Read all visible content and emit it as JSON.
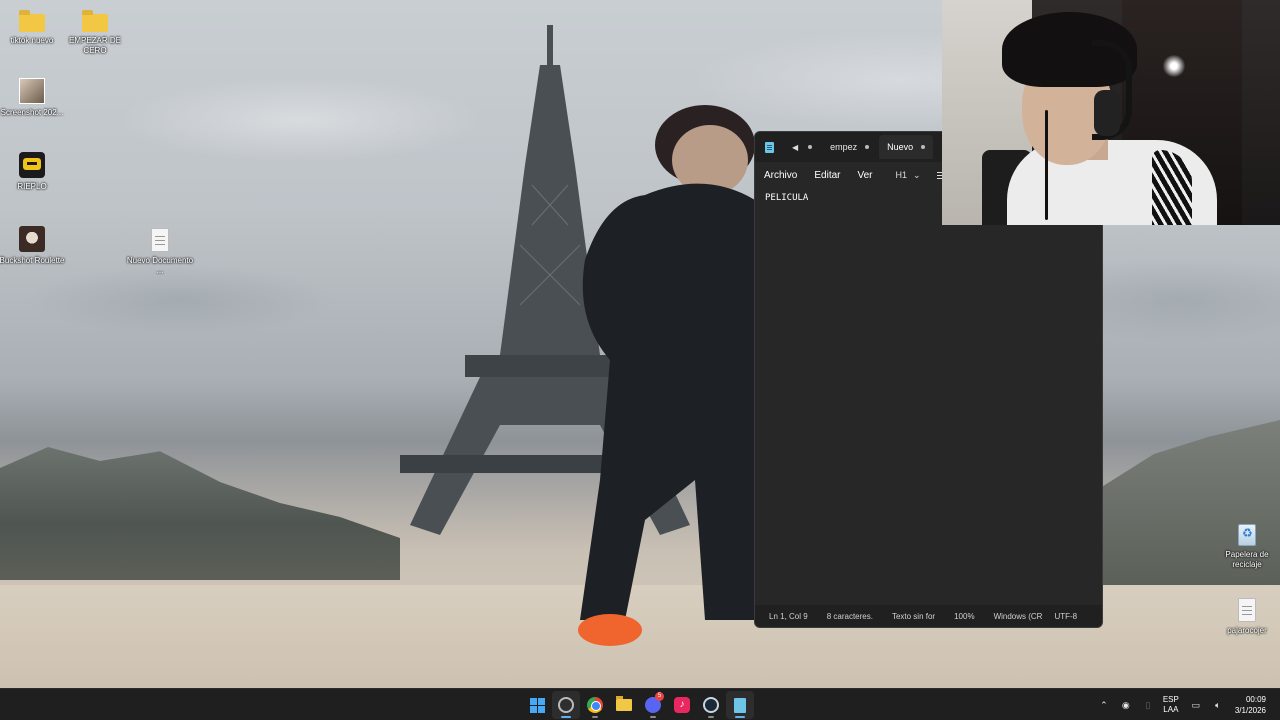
{
  "desktop": {
    "icons": [
      {
        "label": "tiktok nuevo",
        "icon": "folder-icon"
      },
      {
        "label": "EMPEZAR DE CERO",
        "icon": "folder-icon"
      },
      {
        "label": "Screenshot 202...",
        "icon": "image-icon"
      },
      {
        "label": "RIEPLO",
        "icon": "game-icon"
      },
      {
        "label": "Buckshot Roulette",
        "icon": "game-icon"
      },
      {
        "label": "Nuevo Documento ...",
        "icon": "text-document-icon"
      },
      {
        "label": "Papelera de reciclaje",
        "icon": "recycle-bin-icon"
      },
      {
        "label": "pajarocojer",
        "icon": "text-document-icon"
      }
    ]
  },
  "notepad": {
    "tabs": [
      {
        "label": "empez",
        "active": false
      },
      {
        "label": "Nuevo",
        "active": true
      }
    ],
    "menu": {
      "archivo": "Archivo",
      "editar": "Editar",
      "ver": "Ver",
      "heading": "H1"
    },
    "content": "PELICULA",
    "status": {
      "position": "Ln 1, Col 9",
      "chars": "8 caracteres.",
      "format": "Texto sin for",
      "zoom": "100%",
      "line_ending": "Windows (CR",
      "encoding": "UTF-8"
    }
  },
  "taskbar": {
    "apps": [
      {
        "name": "start",
        "icon": "windows-icon"
      },
      {
        "name": "obs",
        "icon": "obs-icon",
        "active": true
      },
      {
        "name": "chrome",
        "icon": "chrome-icon"
      },
      {
        "name": "explorer",
        "icon": "file-explorer-icon"
      },
      {
        "name": "discord",
        "icon": "discord-icon",
        "badge": "5"
      },
      {
        "name": "tiktok",
        "icon": "tiktok-icon"
      },
      {
        "name": "steam",
        "icon": "steam-icon"
      },
      {
        "name": "notepad",
        "icon": "notepad-icon",
        "active": true
      }
    ],
    "tray": {
      "lang_top": "ESP",
      "lang_bottom": "LAA",
      "time": "00:09",
      "date": "3/1/2026"
    }
  },
  "colors": {
    "taskbar_bg": "#1f1f1f",
    "notepad_bg": "#272727",
    "accent": "#47a9f5"
  }
}
